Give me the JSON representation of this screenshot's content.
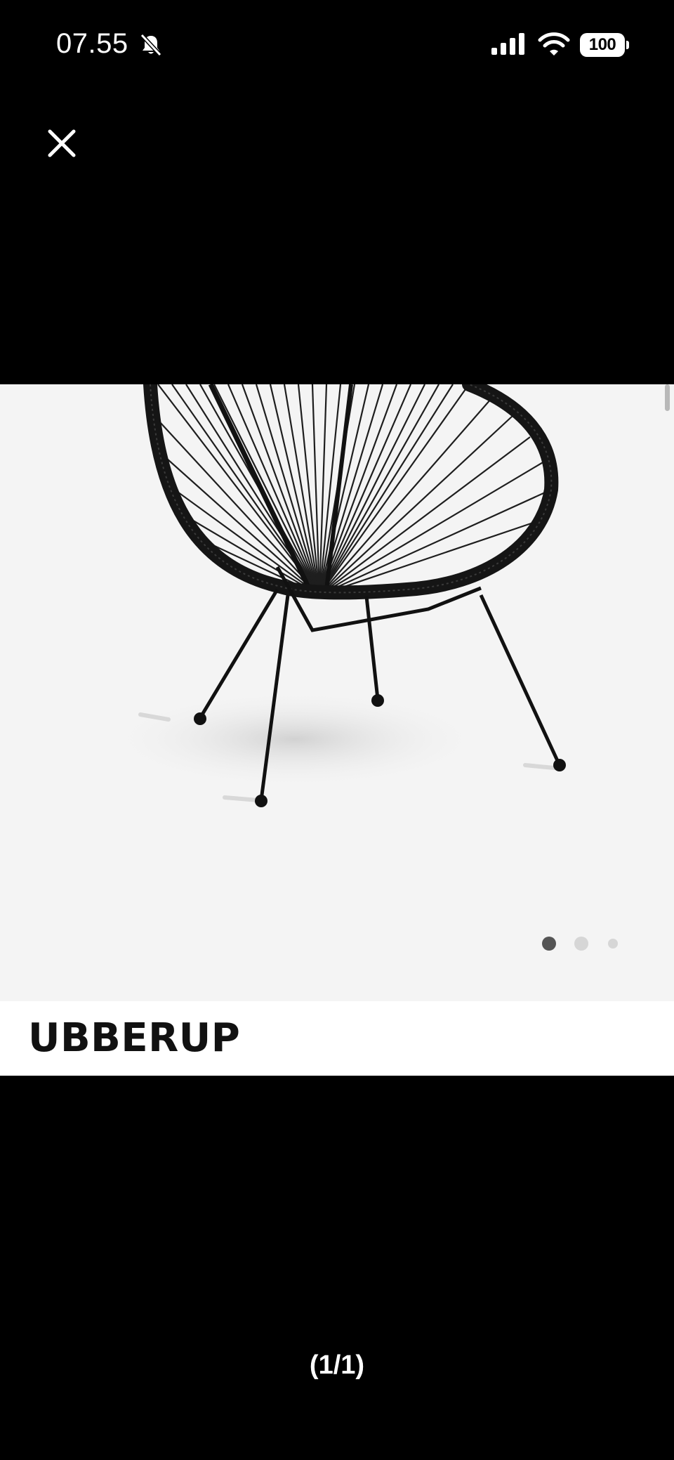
{
  "status_bar": {
    "time": "07.55",
    "battery_level": "100",
    "icons": [
      "bell-slash-icon",
      "cellular-signal-icon",
      "wifi-icon",
      "battery-icon"
    ]
  },
  "viewer": {
    "close_icon": "close-icon",
    "counter": "(1/1)",
    "background_color": "#000000"
  },
  "product": {
    "name": "UBBERUP",
    "image_icon": "chair-image",
    "image_background": "#f4f4f4",
    "pagination": {
      "current": 1,
      "total": 3
    }
  }
}
